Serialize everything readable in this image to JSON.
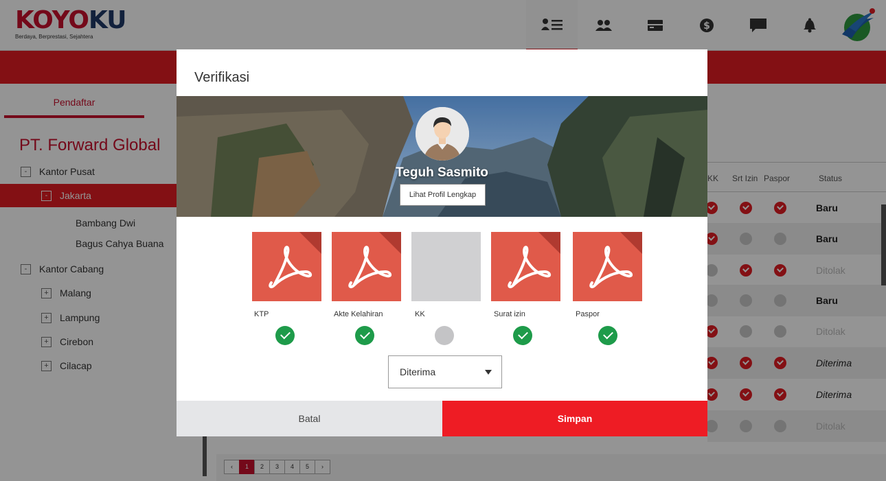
{
  "brand": {
    "logo_red": "KOYO",
    "logo_blue": "KU",
    "tagline": "Berdaya, Berprestasi, Sejahtera"
  },
  "nav": {
    "items": [
      {
        "icon": "member-list-icon",
        "active": true
      },
      {
        "icon": "group-icon",
        "active": false
      },
      {
        "icon": "card-icon",
        "active": false
      },
      {
        "icon": "dollar-icon",
        "active": false
      },
      {
        "icon": "chat-icon",
        "active": false
      },
      {
        "icon": "bell-icon",
        "active": false
      }
    ]
  },
  "sidebar": {
    "tab": "Pendaftar",
    "company": "PT. Forward Global",
    "tree": {
      "kantor_pusat": {
        "toggle": "-",
        "label": "Kantor Pusat"
      },
      "jakarta": {
        "toggle": "-",
        "label": "Jakarta"
      },
      "members": [
        "Bambang Dwi",
        "Bagus Cahya Buana"
      ],
      "kantor_cabang": {
        "toggle": "-",
        "label": "Kantor Cabang"
      },
      "branches": [
        {
          "toggle": "+",
          "label": "Malang"
        },
        {
          "toggle": "+",
          "label": "Lampung"
        },
        {
          "toggle": "+",
          "label": "Cirebon"
        },
        {
          "toggle": "+",
          "label": "Cilacap"
        }
      ]
    }
  },
  "table": {
    "headers": {
      "kk": "KK",
      "srt_izin": "Srt Izin",
      "paspor": "Paspor",
      "status": "Status"
    },
    "rows": [
      {
        "kk": "red",
        "srt": "red",
        "pas": "red",
        "status": "Baru",
        "style": "baru"
      },
      {
        "kk": "red",
        "srt": "grey",
        "pas": "grey",
        "status": "Baru",
        "style": "baru"
      },
      {
        "kk": "grey",
        "srt": "red",
        "pas": "red",
        "status": "Ditolak",
        "style": "ditolak"
      },
      {
        "kk": "grey",
        "srt": "grey",
        "pas": "grey",
        "status": "Baru",
        "style": "baru"
      },
      {
        "kk": "red",
        "srt": "grey",
        "pas": "grey",
        "status": "Ditolak",
        "style": "ditolak"
      },
      {
        "kk": "red",
        "srt": "red",
        "pas": "red",
        "status": "Diterima",
        "style": "diterima"
      },
      {
        "kk": "red",
        "srt": "red",
        "pas": "red",
        "status": "Diterima",
        "style": "diterima"
      },
      {
        "kk": "grey",
        "srt": "grey",
        "pas": "grey",
        "status": "Ditolak",
        "style": "ditolak"
      }
    ]
  },
  "pagination": {
    "prev": "‹",
    "pages": [
      "1",
      "2",
      "3",
      "4",
      "5"
    ],
    "current": "1",
    "next": "›"
  },
  "modal": {
    "title": "Verifikasi",
    "user_name": "Teguh Sasmito",
    "profile_button": "Lihat Profil Lengkap",
    "documents": [
      {
        "label": "KTP",
        "uploaded": true,
        "verified": true
      },
      {
        "label": "Akte Kelahiran",
        "uploaded": true,
        "verified": true
      },
      {
        "label": "KK",
        "uploaded": false,
        "verified": false
      },
      {
        "label": "Surat izin",
        "uploaded": true,
        "verified": true
      },
      {
        "label": "Paspor",
        "uploaded": true,
        "verified": true
      }
    ],
    "status_select": {
      "value": "Diterima"
    },
    "cancel_button": "Batal",
    "save_button": "Simpan"
  },
  "colors": {
    "brand_red": "#e21d24",
    "brand_navy": "#1f3a68",
    "pdf_red": "#e05a4a",
    "success_green": "#1e9b4a"
  }
}
